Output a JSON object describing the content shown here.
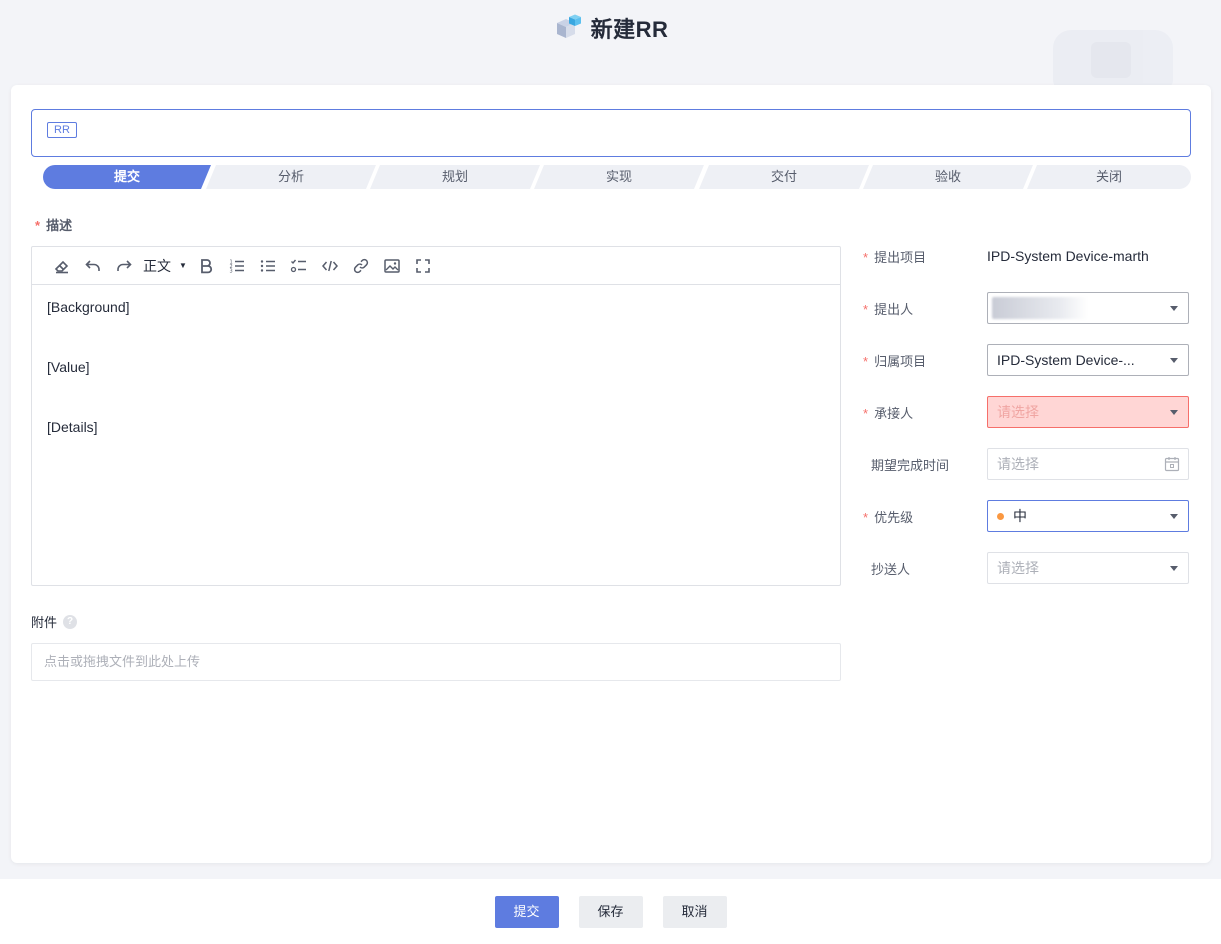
{
  "header": {
    "title": "新建RR",
    "logo_icon": "cube-logo-icon"
  },
  "title_input": {
    "tag": "RR",
    "value": ""
  },
  "steps": [
    {
      "label": "提交",
      "active": true
    },
    {
      "label": "分析",
      "active": false
    },
    {
      "label": "规划",
      "active": false
    },
    {
      "label": "实现",
      "active": false
    },
    {
      "label": "交付",
      "active": false
    },
    {
      "label": "验收",
      "active": false
    },
    {
      "label": "关闭",
      "active": false
    }
  ],
  "description": {
    "required_mark": "*",
    "label": "描述",
    "toolbar": {
      "heading_label": "正文",
      "icons": [
        "eraser-icon",
        "undo-icon",
        "redo-icon",
        "bold-icon",
        "ordered-list-icon",
        "bullet-list-icon",
        "task-list-icon",
        "code-icon",
        "link-icon",
        "image-icon",
        "fullscreen-icon"
      ]
    },
    "content": [
      "[Background]",
      "[Value]",
      "[Details]"
    ]
  },
  "attachment": {
    "label": "附件",
    "upload_placeholder": "点击或拖拽文件到此处上传"
  },
  "form": {
    "project": {
      "label": "提出项目",
      "value": "IPD-System Device-marth"
    },
    "proposer": {
      "label": "提出人",
      "value": ""
    },
    "belong_project": {
      "label": "归属项目",
      "value": "IPD-System Device-..."
    },
    "assignee": {
      "label": "承接人",
      "placeholder": "请选择"
    },
    "due_date": {
      "label": "期望完成时间",
      "placeholder": "请选择"
    },
    "priority": {
      "label": "优先级",
      "value": "中",
      "dot_color": "#fa9841"
    },
    "cc": {
      "label": "抄送人",
      "placeholder": "请选择"
    }
  },
  "footer": {
    "submit_label": "提交",
    "save_label": "保存",
    "cancel_label": "取消"
  },
  "colors": {
    "accent": "#5e7ce0",
    "error_bg": "#ffd6d5",
    "required": "#f66f6a"
  }
}
